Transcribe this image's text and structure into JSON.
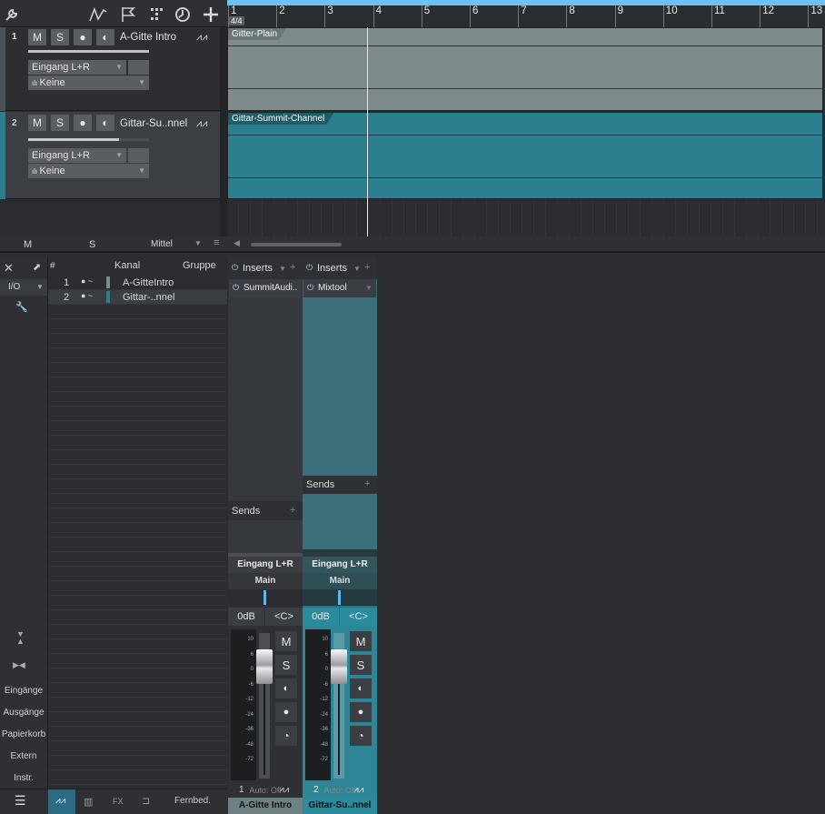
{
  "toolbar": {
    "icons": [
      "wrench-icon",
      "automation-icon",
      "marker-flag-icon",
      "grid-icon",
      "clock-icon",
      "add-track-icon"
    ]
  },
  "ruler": {
    "signature": "4/4",
    "bars": [
      "1",
      "2",
      "3",
      "4",
      "5",
      "6",
      "7",
      "8",
      "9",
      "10",
      "11",
      "12",
      "13"
    ]
  },
  "tracks": [
    {
      "num": "1",
      "name": "A-Gitte Intro",
      "mute": "M",
      "solo": "S",
      "input": "Eingang L+R",
      "output": "Keine",
      "clip": "Gitter-Plain",
      "color": "#7d8b8c"
    },
    {
      "num": "2",
      "name": "Gittar-Su..nnel",
      "mute": "M",
      "solo": "S",
      "input": "Eingang L+R",
      "output": "Keine",
      "clip": "Gittar-Summit-Channel",
      "color": "#2b7f8f"
    }
  ],
  "bottombar": {
    "m": "M",
    "s": "S",
    "mode": "Mittel"
  },
  "leftpanel": {
    "io": "I/O",
    "items": [
      "Eingänge",
      "Ausgänge",
      "Papierkorb",
      "Extern",
      "Instr."
    ],
    "footer": [
      "Fernbed.",
      "FX"
    ]
  },
  "list": {
    "headers": {
      "num": "#",
      "channel": "Kanal",
      "group": "Gruppe"
    },
    "rows": [
      {
        "num": "1",
        "name": "A-GitteIntro"
      },
      {
        "num": "2",
        "name": "Gittar-..nnel"
      }
    ]
  },
  "channels": [
    {
      "inserts": "Inserts",
      "insert_item": "SummitAudi..",
      "sends": "Sends",
      "input": "Eingang L+R",
      "output": "Main",
      "volume": "0dB",
      "pan": "<C>",
      "mute": "M",
      "solo": "S",
      "num": "1",
      "auto": "Auto: Off",
      "name": "A-Gitte Intro"
    },
    {
      "inserts": "Inserts",
      "insert_item": "Mixtool",
      "sends": "Sends",
      "input": "Eingang L+R",
      "output": "Main",
      "volume": "0dB",
      "pan": "<C>",
      "mute": "M",
      "solo": "S",
      "num": "2",
      "auto": "Auto: Off",
      "name": "Gittar-Su..nnel"
    }
  ],
  "meter_scale": [
    "10",
    "6",
    "0",
    "-6",
    "-12",
    "-24",
    "-36",
    "-48",
    "-72"
  ]
}
